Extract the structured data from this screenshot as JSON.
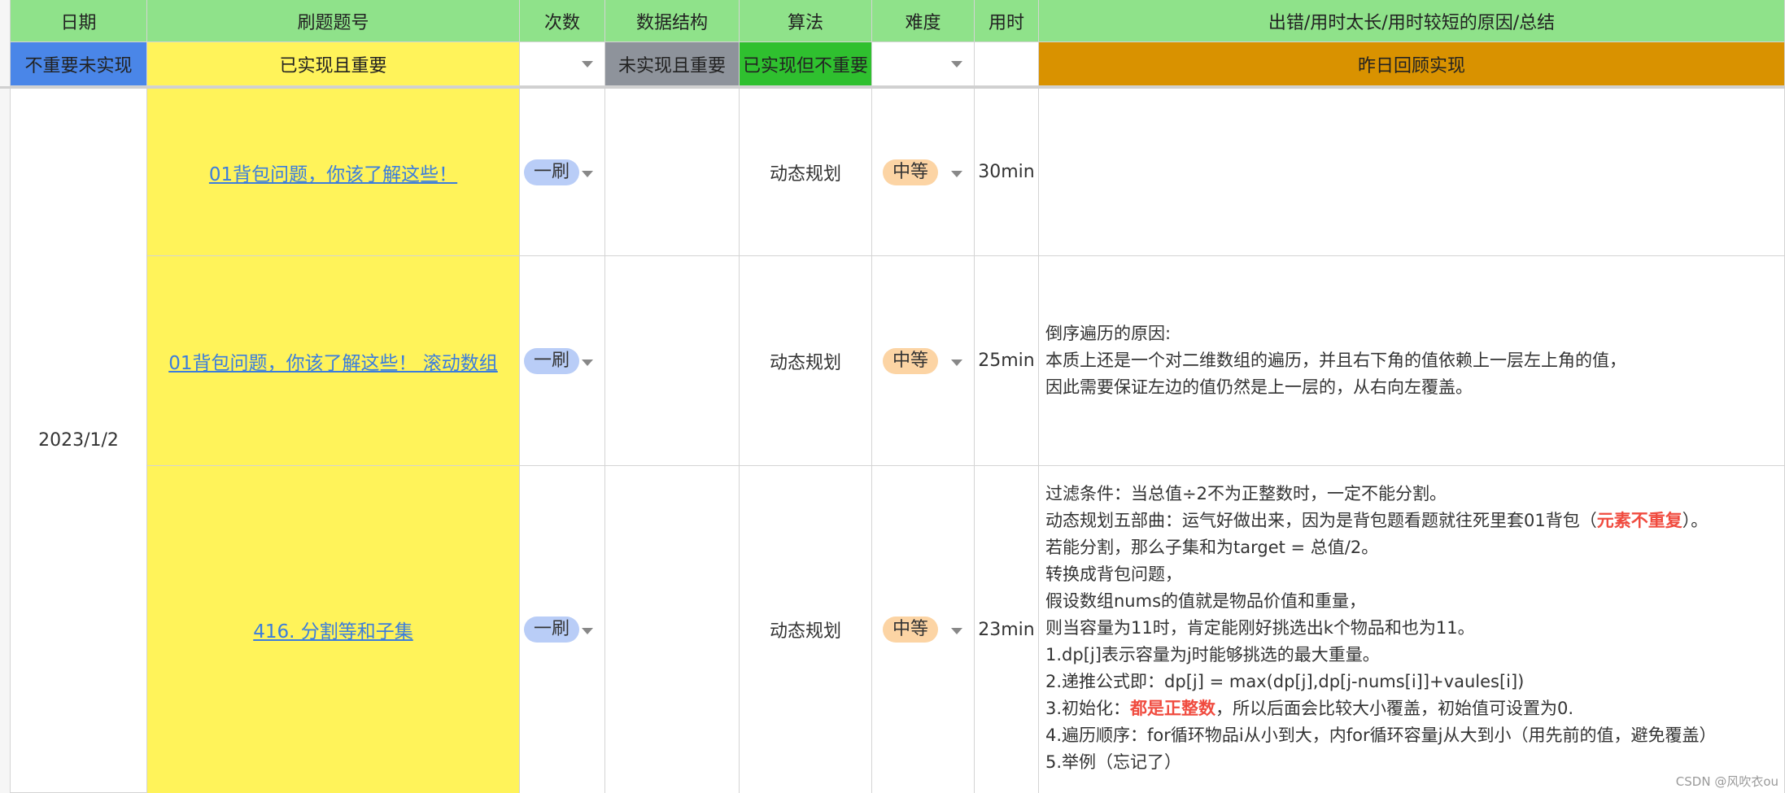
{
  "headers": {
    "date": "日期",
    "problem": "刷题题号",
    "count": "次数",
    "structure": "数据结构",
    "algorithm": "算法",
    "difficulty": "难度",
    "time": "用时",
    "summary": "出错/用时太长/用时较短的原因/总结"
  },
  "legend": {
    "not_important_not_done": "不重要未实现",
    "done_and_important": "已实现且重要",
    "not_done_important": "未实现且重要",
    "done_not_important": "已实现但不重要",
    "review_yesterday": "昨日回顾实现"
  },
  "colors": {
    "header_green": "#8fe28a",
    "legend_blue": "#4a86e8",
    "legend_yellow": "#fff35a",
    "legend_gray": "#8e939b",
    "legend_green": "#2fc02f",
    "legend_orange": "#d99200",
    "count_tag": "#b9cdf7",
    "difficulty_tag": "#fcd4a4",
    "link": "#3b7ddd",
    "highlight_red": "#f04b3f"
  },
  "date_value": "2023/1/2",
  "rows": [
    {
      "problem": "01背包问题，你该了解这些！",
      "count": "一刷",
      "structure": "",
      "algorithm": "动态规划",
      "difficulty": "中等",
      "time": "30min",
      "notes": []
    },
    {
      "problem": "01背包问题，你该了解这些！ 滚动数组",
      "count": "一刷",
      "structure": "",
      "algorithm": "动态规划",
      "difficulty": "中等",
      "time": "25min",
      "notes": [
        "倒序遍历的原因:",
        "本质上还是一个对二维数组的遍历，并且右下角的值依赖上一层左上角的值，",
        "因此需要保证左边的值仍然是上一层的，从右向左覆盖。"
      ]
    },
    {
      "problem": "416. 分割等和子集",
      "count": "一刷",
      "structure": "",
      "algorithm": "动态规划",
      "difficulty": "中等",
      "time": "23min",
      "notes": {
        "l1": "过滤条件：当总值÷2不为正整数时，一定不能分割。",
        "l2a": "动态规划五部曲：运气好做出来，因为是背包题看题就往死里套01背包（",
        "l2b": "元素不重复",
        "l2c": "）。",
        "l3": "若能分割，那么子集和为target = 总值/2。",
        "l4": "转换成背包问题，",
        "l5": "假设数组nums的值就是物品价值和重量，",
        "l6": "则当容量为11时，肯定能刚好挑选出k个物品和也为11。",
        "l7": "1.dp[j]表示容量为j时能够挑选的最大重量。",
        "l8": "2.递推公式即：dp[j] = max(dp[j],dp[j-nums[i]]+vaules[i])",
        "l9a": "3.初始化：",
        "l9b": "都是正整数",
        "l9c": "，所以后面会比较大小覆盖，初始值可设置为0.",
        "l10": "4.遍历顺序：for循环物品i从小到大，内for循环容量j从大到小（用先前的值，避免覆盖）",
        "l11": "5.举例（忘记了）"
      }
    }
  ],
  "watermark": "CSDN @风吹衣ou"
}
